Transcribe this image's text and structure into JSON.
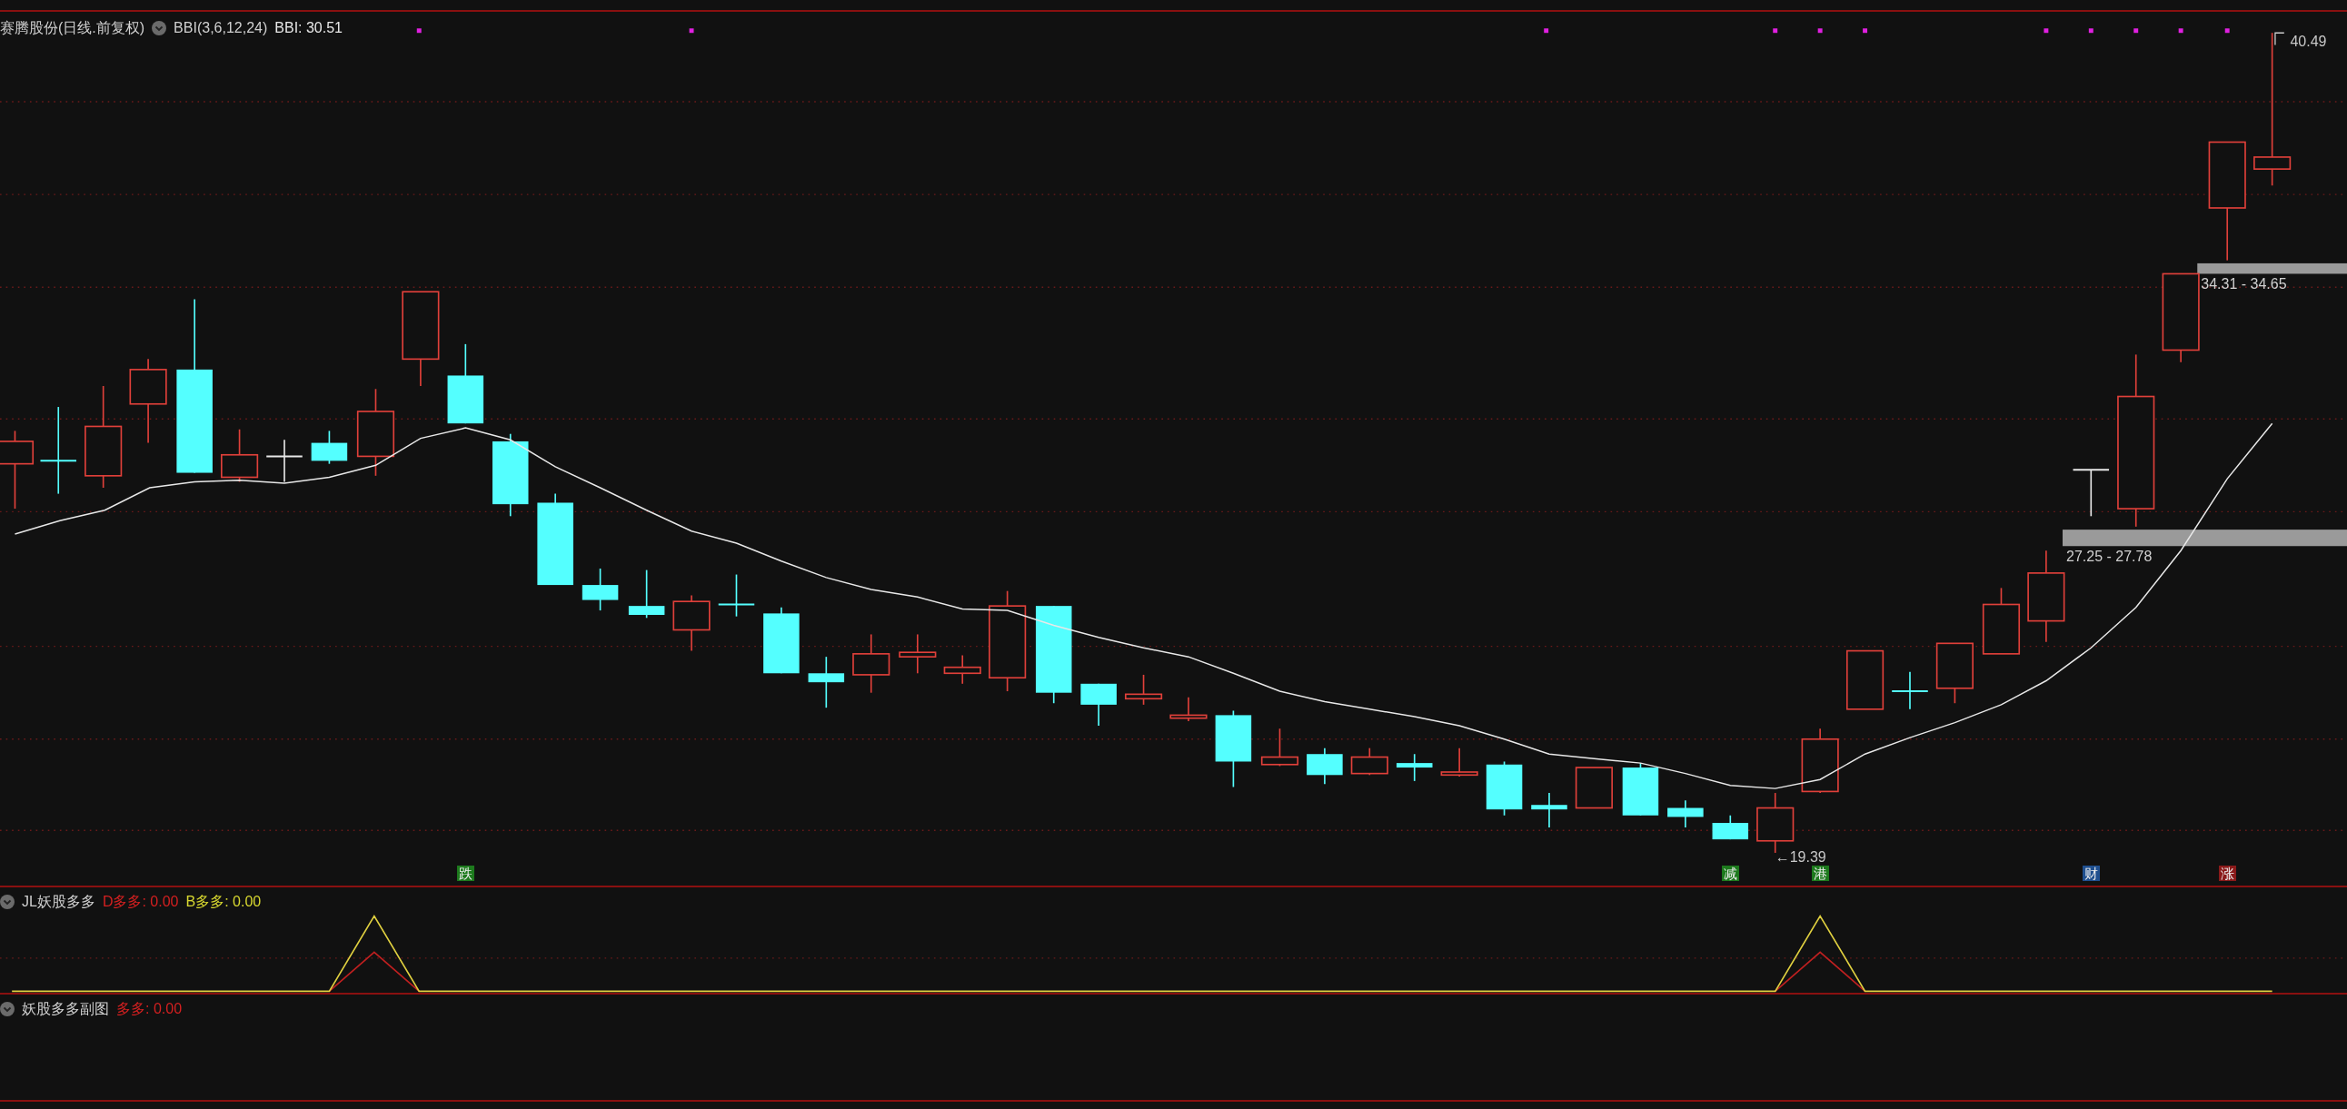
{
  "main_panel": {
    "title": "赛腾股份(日线.前复权)",
    "indicator": "BBI(3,6,12,24)",
    "reading": "BBI: 30.51",
    "price_labels": [
      {
        "text": "40.49"
      },
      {
        "text": "←19.39"
      }
    ],
    "zones": [
      {
        "text": "34.31 - 34.65"
      },
      {
        "text": "27.25 - 27.78"
      }
    ],
    "signals": [
      {
        "text": "跌",
        "color": "#1d7a1d"
      },
      {
        "text": "减",
        "color": "#1d7a1d"
      },
      {
        "text": "港",
        "color": "#1d7a1d"
      },
      {
        "text": "财",
        "color": "#1f4f8f"
      },
      {
        "text": "涨",
        "color": "#8a1a1a"
      }
    ]
  },
  "sub_panels": [
    {
      "title": "JL妖股多多",
      "readings": [
        {
          "label": "D多多: 0.00",
          "color": "#d42020"
        },
        {
          "label": "B多多: 0.00",
          "color": "#d8d830"
        }
      ]
    },
    {
      "title": "妖股多多副图",
      "readings": [
        {
          "label": "多多: 0.00",
          "color": "#d42020"
        }
      ]
    }
  ]
}
